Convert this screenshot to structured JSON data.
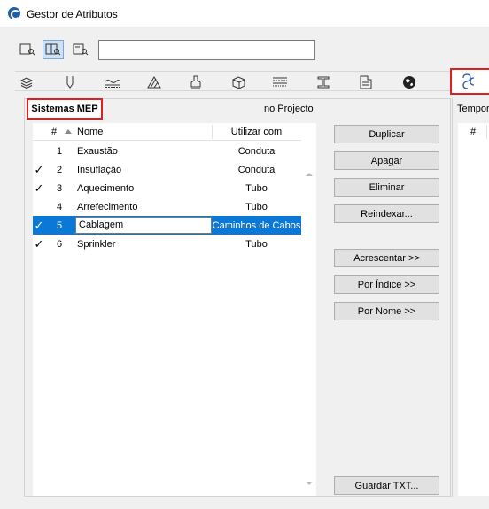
{
  "window": {
    "title": "Gestor de Atributos",
    "icon": "archicad-logo-icon"
  },
  "toolbar": {
    "view_buttons": [
      "single-pane-view-icon",
      "dual-pane-view-icon",
      "detail-view-icon"
    ],
    "search": {
      "value": "",
      "placeholder": ""
    }
  },
  "tabs": [
    {
      "icon": "layers-icon"
    },
    {
      "icon": "pen-icon"
    },
    {
      "icon": "line-types-icon"
    },
    {
      "icon": "fill-types-icon"
    },
    {
      "icon": "surfaces-icon"
    },
    {
      "icon": "building-materials-icon"
    },
    {
      "icon": "composites-icon"
    },
    {
      "icon": "profiles-icon"
    },
    {
      "icon": "zone-categories-icon"
    },
    {
      "icon": "globe-icon"
    },
    {
      "icon": "mep-systems-icon",
      "active": true
    }
  ],
  "left": {
    "section_title": "Sistemas MEP",
    "subtitle": "no Projecto",
    "columns": {
      "num": "#",
      "name": "Nome",
      "use_with": "Utilizar com"
    },
    "rows": [
      {
        "checked": false,
        "num": "1",
        "name": "Exaustão",
        "use_with": "Conduta",
        "selected": false
      },
      {
        "checked": true,
        "num": "2",
        "name": "Insuflação",
        "use_with": "Conduta",
        "selected": false
      },
      {
        "checked": true,
        "num": "3",
        "name": "Aquecimento",
        "use_with": "Tubo",
        "selected": false
      },
      {
        "checked": false,
        "num": "4",
        "name": "Arrefecimento",
        "use_with": "Tubo",
        "selected": false
      },
      {
        "checked": true,
        "num": "5",
        "name": "Cablagem",
        "use_with": "Caminhos de Cabos",
        "selected": true
      },
      {
        "checked": true,
        "num": "6",
        "name": "Sprinkler",
        "use_with": "Tubo",
        "selected": false
      }
    ],
    "check_glyph": "✓"
  },
  "actions": {
    "duplicate": "Duplicar",
    "clear": "Apagar",
    "delete": "Eliminar",
    "reindex": "Reindexar...",
    "append": "Acrescentar >>",
    "by_index": "Por Índice >>",
    "by_name": "Por Nome >>",
    "save_txt": "Guardar TXT..."
  },
  "right": {
    "title": "Tempor",
    "col_num": "#"
  },
  "colors": {
    "highlight": "#e02020",
    "selection": "#0a78d7"
  }
}
